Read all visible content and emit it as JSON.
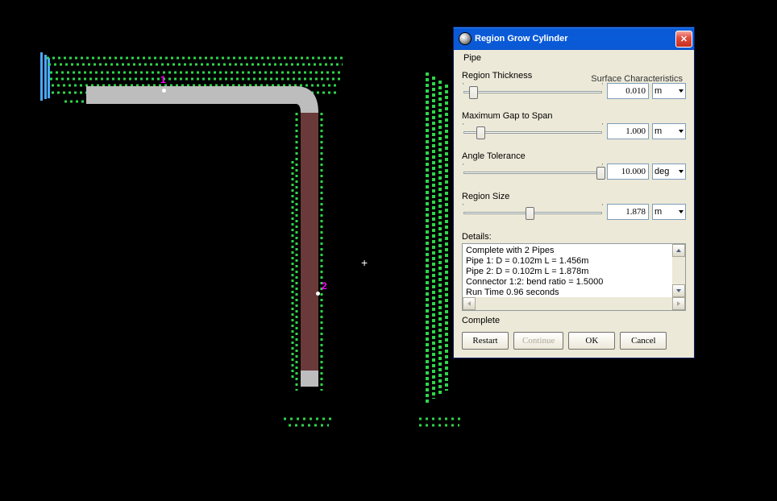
{
  "viewport": {
    "marker1": "1",
    "marker2": "2"
  },
  "dialog": {
    "title": "Region Grow Cylinder",
    "menu": {
      "pipe": "Pipe"
    },
    "section": "Surface Characteristics",
    "fields": {
      "thickness": {
        "label": "Region Thickness",
        "value": "0.010",
        "unit": "m",
        "pos": 5
      },
      "gap": {
        "label": "Maximum Gap to Span",
        "value": "1.000",
        "unit": "m",
        "pos": 10
      },
      "angle": {
        "label": "Angle Tolerance",
        "value": "10.000",
        "unit": "deg",
        "pos": 95
      },
      "size": {
        "label": "Region Size",
        "value": "1.878",
        "unit": "m",
        "pos": 45
      }
    },
    "details": {
      "label": "Details:",
      "lines": [
        "Complete with 2 Pipes",
        "Pipe   1: D = 0.102m  L = 1.456m",
        "Pipe   2: D = 0.102m  L = 1.878m",
        "Connector 1:2: bend ratio = 1.5000",
        "Run Time     0.96 seconds"
      ]
    },
    "status": "Complete",
    "buttons": {
      "restart": "Restart",
      "continue": "Continue",
      "ok": "OK",
      "cancel": "Cancel"
    }
  }
}
